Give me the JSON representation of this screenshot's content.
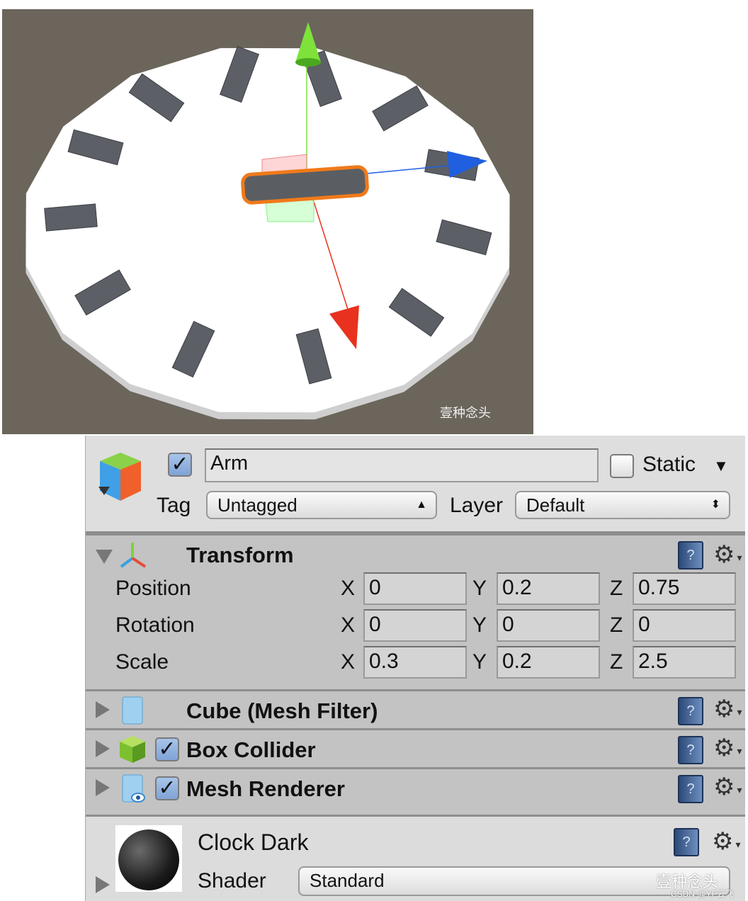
{
  "scene": {
    "background": "#6b655c",
    "watermark": "壹种念头",
    "selection_outline": "#f07a1a",
    "axis_colors": {
      "x": "#e8321e",
      "y": "#7ee23a",
      "z": "#1f5fe0"
    }
  },
  "header": {
    "active": true,
    "name": "Arm",
    "static_label": "Static",
    "static_checked": false,
    "tag_label": "Tag",
    "tag_value": "Untagged",
    "layer_label": "Layer",
    "layer_value": "Default"
  },
  "transform": {
    "title": "Transform",
    "expanded": true,
    "rows": [
      {
        "label": "Position",
        "x": "0",
        "y": "0.2",
        "z": "0.75"
      },
      {
        "label": "Rotation",
        "x": "0",
        "y": "0",
        "z": "0"
      },
      {
        "label": "Scale",
        "x": "0.3",
        "y": "0.2",
        "z": "2.5"
      }
    ],
    "axes": {
      "x": "X",
      "y": "Y",
      "z": "Z"
    }
  },
  "components": [
    {
      "title": "Cube (Mesh Filter)",
      "has_checkbox": false,
      "icon": "mesh-filter-icon"
    },
    {
      "title": "Box Collider",
      "has_checkbox": true,
      "checked": true,
      "icon": "box-collider-icon"
    },
    {
      "title": "Mesh Renderer",
      "has_checkbox": true,
      "checked": true,
      "icon": "mesh-renderer-icon"
    }
  ],
  "material": {
    "name": "Clock Dark",
    "shader_label": "Shader",
    "shader_value": "Standard",
    "watermark": "壹种念头",
    "credit": "CSDN @YF云飞"
  },
  "icons": {
    "help": "?",
    "gear": "⚙",
    "check": "✓"
  }
}
